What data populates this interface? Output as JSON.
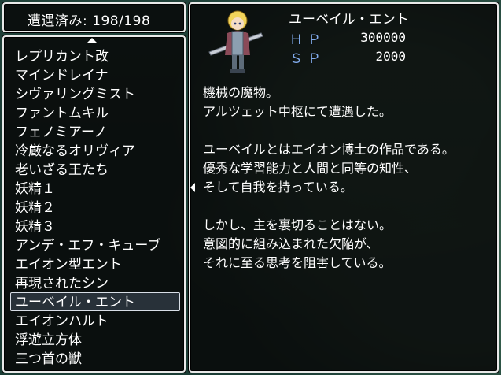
{
  "counter": {
    "label": "遭遇済み:",
    "value": "198/198"
  },
  "enemy_list": [
    "レプリカント改",
    "マインドレイナ",
    "シヴァリングミスト",
    "ファントムキル",
    "フェノミアーノ",
    "冷厳なるオリヴィア",
    "老いざる王たち",
    "妖精１",
    "妖精２",
    "妖精３",
    "アンデ・エフ・キューブ",
    "エイオン型エント",
    "再現されたシン",
    "ユーベイル・エント",
    "エイオンハルト",
    "浮遊立方体",
    "三つ首の獣"
  ],
  "selected_index": 13,
  "detail": {
    "name": "ユーベイル・エント",
    "hp_label": "ＨＰ",
    "hp_value": "300000",
    "sp_label": "ＳＰ",
    "sp_value": "2000",
    "lines": [
      "機械の魔物。",
      "アルツェット中枢にて遭遇した。",
      "",
      "ユーベイルとはエイオン博士の作品である。",
      "優秀な学習能力と人間と同等の知性、",
      "そして自我を持っている。",
      "",
      "しかし、主を裏切ることはない。",
      "意図的に組み込まれた欠陥が、",
      "それに至る思考を阻害している。"
    ]
  },
  "icons": {
    "scroll_up": "arrow-up-icon",
    "page_left": "arrow-left-icon"
  }
}
